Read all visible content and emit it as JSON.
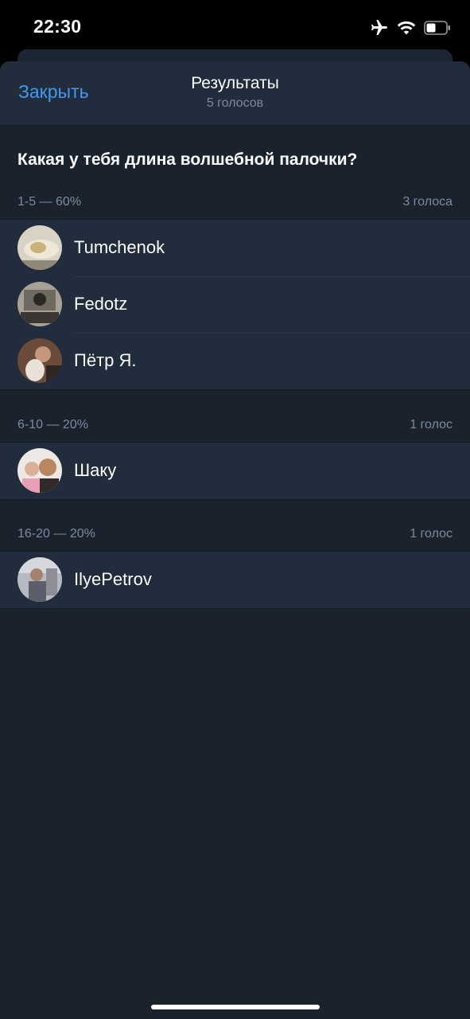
{
  "status_bar": {
    "time": "22:30",
    "icons": [
      "airplane-icon",
      "wifi-icon",
      "battery-icon"
    ]
  },
  "header": {
    "close_label": "Закрыть",
    "title": "Результаты",
    "subtitle": "5 голосов"
  },
  "question": "Какая у тебя длина волшебной палочки?",
  "sections": [
    {
      "option": "1-5 — 60%",
      "count": "3 голоса",
      "voters": [
        {
          "name": "Tumchenok"
        },
        {
          "name": "Fedotz"
        },
        {
          "name": "Пётр Я."
        }
      ]
    },
    {
      "option": "6-10 — 20%",
      "count": "1 голос",
      "voters": [
        {
          "name": "Шаку"
        }
      ]
    },
    {
      "option": "16-20 — 20%",
      "count": "1 голос",
      "voters": [
        {
          "name": "IlyePetrov"
        }
      ]
    }
  ],
  "colors": {
    "accent": "#3e9bf0",
    "background": "#1a222d",
    "row_background": "#212c3c",
    "secondary_text": "#7e8a9a"
  }
}
